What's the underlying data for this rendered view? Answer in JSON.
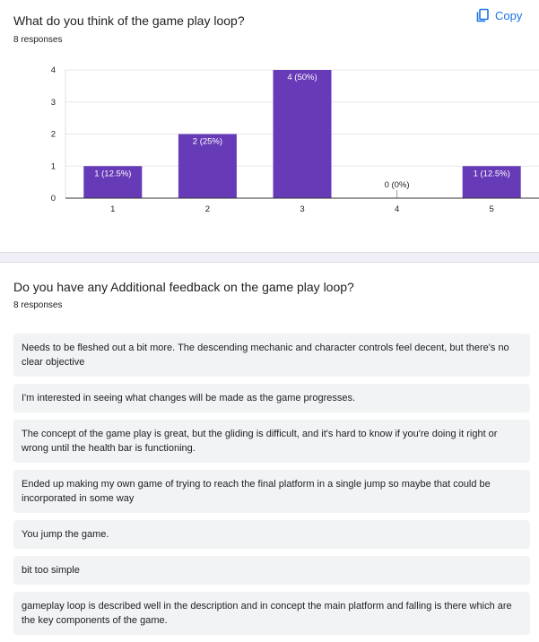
{
  "question1": {
    "title": "What do you think of the game play loop?",
    "responses_count": "8 responses",
    "copy_label": "Copy"
  },
  "chart_data": {
    "type": "bar",
    "categories": [
      "1",
      "2",
      "3",
      "4",
      "5"
    ],
    "values": [
      1,
      2,
      4,
      0,
      1
    ],
    "labels": [
      "1 (12.5%)",
      "2 (25%)",
      "4 (50%)",
      "0 (0%)",
      "1 (12.5%)"
    ],
    "ylim": [
      0,
      4
    ],
    "yticks": [
      "0",
      "1",
      "2",
      "3",
      "4"
    ],
    "bar_color": "#673ab7",
    "grid": true
  },
  "question2": {
    "title": "Do you have any Additional feedback on the game play loop?",
    "responses_count": "8 responses",
    "answers": [
      "Needs to be fleshed out a bit more. The descending mechanic and character controls feel decent, but there's no clear objective",
      "I'm interested in seeing what changes will be made as the game progresses.",
      "The concept of the game play is great, but the gliding is difficult, and it's hard to know if you're doing it right or wrong until the health bar is functioning.",
      "Ended up making my own game of trying to reach the final platform in a single jump so maybe that could be incorporated in some way",
      "You jump the game.",
      "bit too simple",
      "gameplay loop is described well in the description and in concept the main platform and falling is there which are the key components of the game."
    ]
  }
}
